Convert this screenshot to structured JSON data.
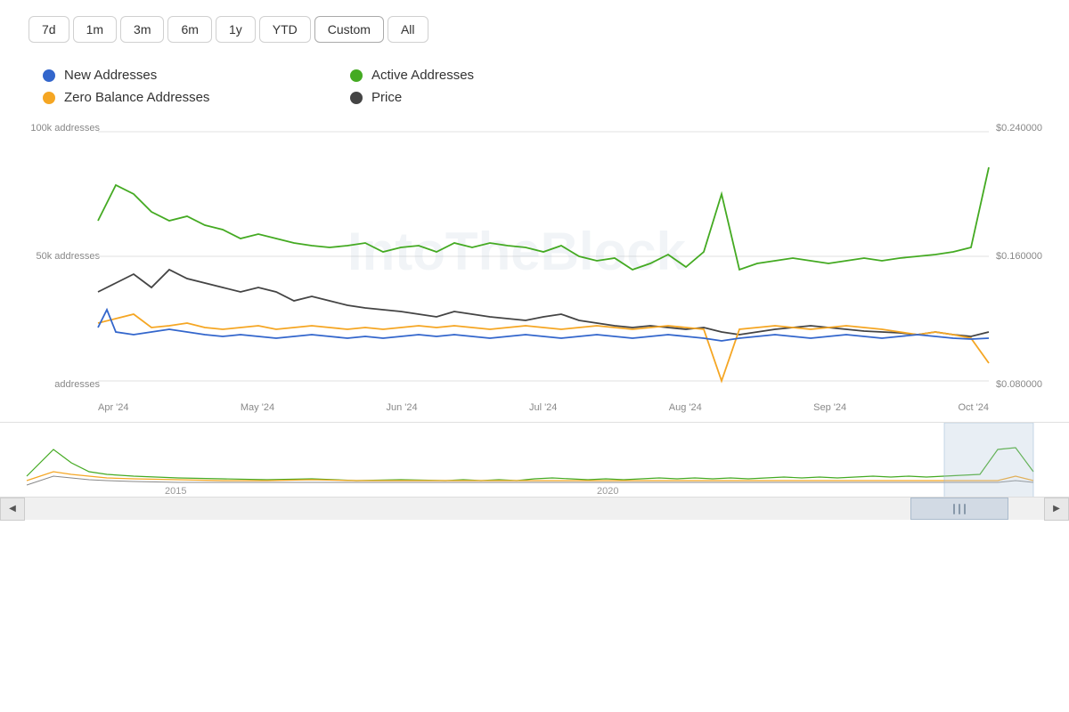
{
  "timeFilters": {
    "buttons": [
      "7d",
      "1m",
      "3m",
      "6m",
      "1y",
      "YTD",
      "Custom",
      "All"
    ],
    "active": "Custom"
  },
  "legend": {
    "items": [
      {
        "id": "new-addresses",
        "label": "New Addresses",
        "color": "#3366cc"
      },
      {
        "id": "active-addresses",
        "label": "Active Addresses",
        "color": "#44aa22"
      },
      {
        "id": "zero-balance",
        "label": "Zero Balance Addresses",
        "color": "#f5a623"
      },
      {
        "id": "price",
        "label": "Price",
        "color": "#444444"
      }
    ]
  },
  "yAxisLeft": {
    "labels": [
      "100k addresses",
      "50k addresses",
      "addresses"
    ]
  },
  "yAxisRight": {
    "labels": [
      "$0.240000",
      "$0.160000",
      "$0.080000"
    ]
  },
  "xAxisLabels": [
    "Apr '24",
    "May '24",
    "Jun '24",
    "Jul '24",
    "Aug '24",
    "Sep '24",
    "Oct '24"
  ],
  "overviewYears": [
    "2015",
    "2020"
  ],
  "navigator": {
    "leftArrow": "◀",
    "rightArrow": "▶"
  },
  "watermark": "IntoTheBlock"
}
